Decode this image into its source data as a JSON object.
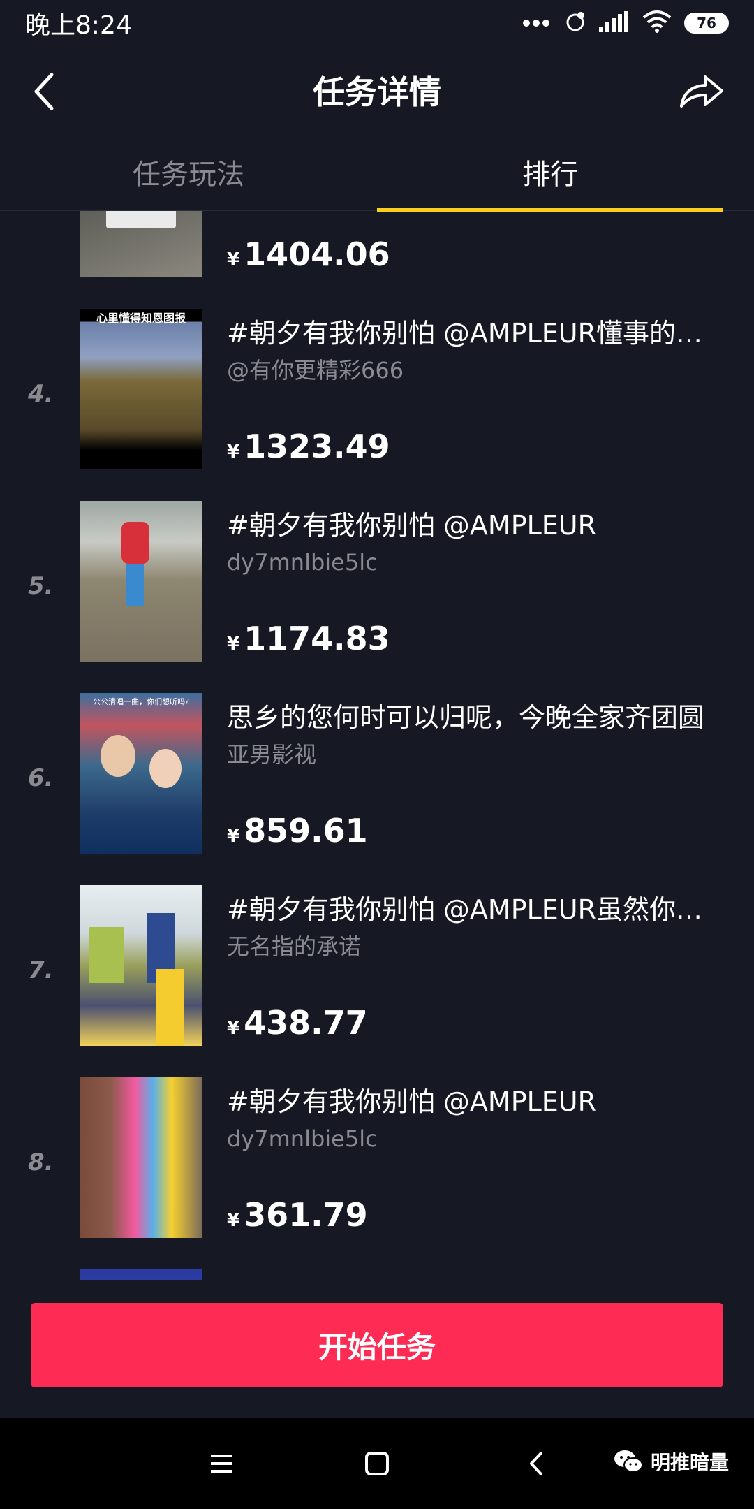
{
  "status_bar": {
    "time": "晚上8:24",
    "battery": "76"
  },
  "header": {
    "title": "任务详情"
  },
  "tabs": [
    {
      "label": "任务玩法",
      "active": false
    },
    {
      "label": "排行",
      "active": true
    }
  ],
  "colors": {
    "background": "#161823",
    "accent_yellow": "#facf1c",
    "cta_red": "#fe2c55",
    "muted_text": "#8a8b91"
  },
  "ranking": [
    {
      "rank": "",
      "title": "",
      "author": "",
      "currency": "¥",
      "amount": "1404.06"
    },
    {
      "rank": "4.",
      "title": "#朝夕有我你别怕 @AMPLEUR懂事的孩子",
      "author": "@有你更精彩666",
      "currency": "¥",
      "amount": "1323.49",
      "thumb_caption": "心里懂得知恩图报"
    },
    {
      "rank": "5.",
      "title": "#朝夕有我你别怕 @AMPLEUR",
      "author": "dy7mnlbie5lc",
      "currency": "¥",
      "amount": "1174.83"
    },
    {
      "rank": "6.",
      "title": "思乡的您何时可以归呢，今晚全家齐团圆",
      "author": "亚男影视",
      "currency": "¥",
      "amount": "859.61",
      "thumb_caption": "公公清唱一曲，你们想听吗?"
    },
    {
      "rank": "7.",
      "title": "#朝夕有我你别怕 @AMPLEUR虽然你不在我身边",
      "author": "无名指的承诺",
      "currency": "¥",
      "amount": "438.77"
    },
    {
      "rank": "8.",
      "title": "#朝夕有我你别怕 @AMPLEUR",
      "author": "dy7mnlbie5lc",
      "currency": "¥",
      "amount": "361.79"
    }
  ],
  "cta": {
    "label": "开始任务"
  },
  "nav_bar": {
    "icons": [
      "menu-icon",
      "home-icon",
      "back-icon"
    ],
    "watermark": "明推暗量"
  }
}
